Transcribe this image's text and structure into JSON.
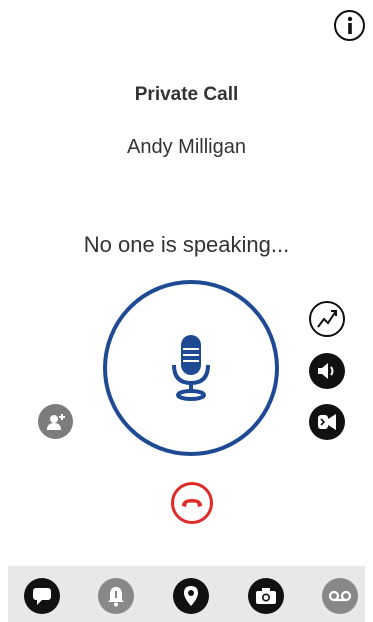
{
  "header": {
    "info_icon": "info-icon"
  },
  "call": {
    "type_label": "Private Call",
    "caller_name": "Andy Milligan",
    "status_text": "No one is speaking..."
  },
  "controls": {
    "ptt_icon": "microphone-icon",
    "side": [
      "analytics-icon",
      "speaker-icon",
      "call-mode-icon"
    ],
    "add_user_icon": "add-user-icon",
    "end_call_icon": "end-call-icon"
  },
  "bottom_nav": [
    {
      "icon": "chat-icon",
      "state": "active"
    },
    {
      "icon": "alert-icon",
      "state": "inactive"
    },
    {
      "icon": "location-icon",
      "state": "active"
    },
    {
      "icon": "camera-icon",
      "state": "active"
    },
    {
      "icon": "voicemail-icon",
      "state": "inactive"
    }
  ],
  "colors": {
    "accent": "#1d4a93",
    "end_call": "#e02a2a",
    "nav_bar": "#e8e8e8",
    "inactive": "#888888"
  }
}
